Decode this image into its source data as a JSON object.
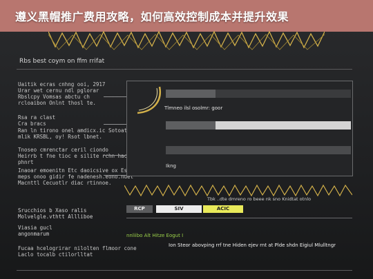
{
  "banner": {
    "title": "遵义黑帽推广费用攻略，如何高效控制成本并提升效果",
    "bg": "#b8766f"
  },
  "colors": {
    "gold": "#d2b04a",
    "green": "#9bd14a",
    "yellow": "#e9ea5a"
  },
  "heading": "Rbs best coym on ffm rrifat",
  "left": {
    "block1": "Uaitik ecras cnhng ooi, 2917\nUrar wet cernu ndl pglorar\nRbslcpy Vomsas abctu ch\nrcloaibon Onlnt thosl te.",
    "block2": "Rsa ra clast\nCra bracs",
    "block3": "Ran ln tirono onel amdicx.ic Sotoats\nmlik KRSBL, oy! Rsot lbnet.",
    "block4": "Tnoseo cmrenctar ceril ciondo\nHeirrb t fne tioc e silite rchn hacnsoc\nphnrt",
    "block5": "Inaoar emoenitn Etc daoicsive ox Esitis\nmeps onoo gidir fe nadenesh.eono.nuet\nMacnttl Cecuotlr diac rtinnoe.",
    "block6": "Srucchios b Xaso ralis\nMolvelgle.vthtt Allliboe",
    "block7": "Viasia gucl\nangonmarum",
    "block8": "Fucaa hcelogrirar nilolten flmoor cone\nLaclo tocalb ctilorlltat"
  },
  "panel": {
    "row1_label": "Tlmneo ilsl osolmr: goor",
    "row2_label": "",
    "row3_text": "Ikng"
  },
  "bottom": {
    "btn_a": "RCP",
    "btn_b": "SIV",
    "btn_c": "ACIC",
    "note": "Tbk ..dte dmreno ro beee nk sno Knidtat otnlo",
    "line1": "nnliibo Alt Hitze Eogut I",
    "line2": "Ion Steor abovping rrf tne Hiden ejev rnt at Plde shdn Eigiul Mlulltngr"
  }
}
